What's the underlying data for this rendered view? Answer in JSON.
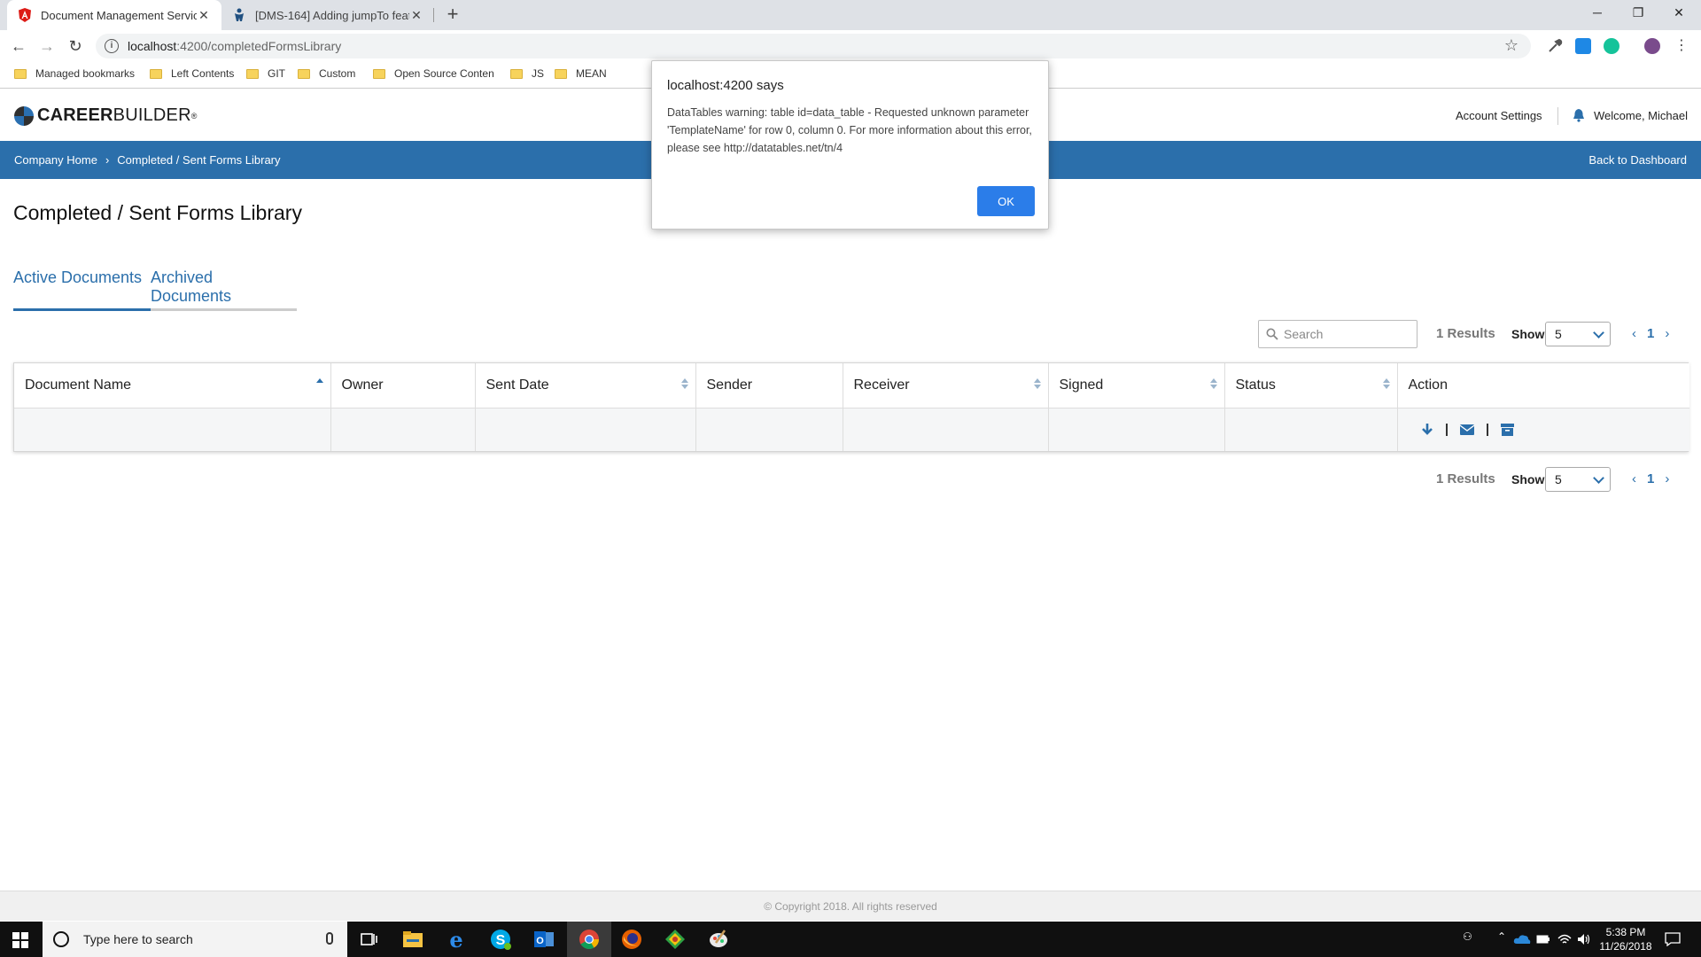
{
  "browser": {
    "tabs": [
      {
        "title": "Document Management Service",
        "active": true
      },
      {
        "title": "[DMS-164] Adding jumpTo featu",
        "active": false
      }
    ],
    "url_host": "localhost",
    "url_path": ":4200/completedFormsLibrary",
    "bookmarks": [
      "Managed bookmarks",
      "Left Contents",
      "GIT",
      "Custom",
      "Open Source Conten",
      "JS",
      "MEAN"
    ]
  },
  "header": {
    "logo_bold": "CAREER",
    "logo_light": "BUILDER",
    "logo_reg": "®",
    "account_settings": "Account Settings",
    "welcome": "Welcome, Michael"
  },
  "breadcrumb": {
    "home": "Company Home",
    "current": "Completed / Sent Forms Library",
    "back": "Back to Dashboard"
  },
  "page": {
    "title": "Completed / Sent Forms Library",
    "tabs": [
      "Active Documents",
      "Archived Documents"
    ]
  },
  "table_controls": {
    "search_placeholder": "Search",
    "results": "1 Results",
    "show_label": "Show",
    "page_size": "5",
    "page": "1"
  },
  "table": {
    "columns": [
      "Document Name",
      "Owner",
      "Sent Date",
      "Sender",
      "Receiver",
      "Signed",
      "Status",
      "Action"
    ]
  },
  "footer": {
    "copyright": "© Copyright 2018. All rights reserved"
  },
  "dialog": {
    "title": "localhost:4200 says",
    "message": "DataTables warning: table id=data_table - Requested unknown parameter 'TemplateName' for row 0, column 0. For more information about this error, please see http://datatables.net/tn/4",
    "ok": "OK"
  },
  "taskbar": {
    "search_placeholder": "Type here to search",
    "time": "5:38 PM",
    "date": "11/26/2018"
  },
  "colors": {
    "brand_blue": "#2b6fab",
    "ok_button": "#2b7de9"
  }
}
